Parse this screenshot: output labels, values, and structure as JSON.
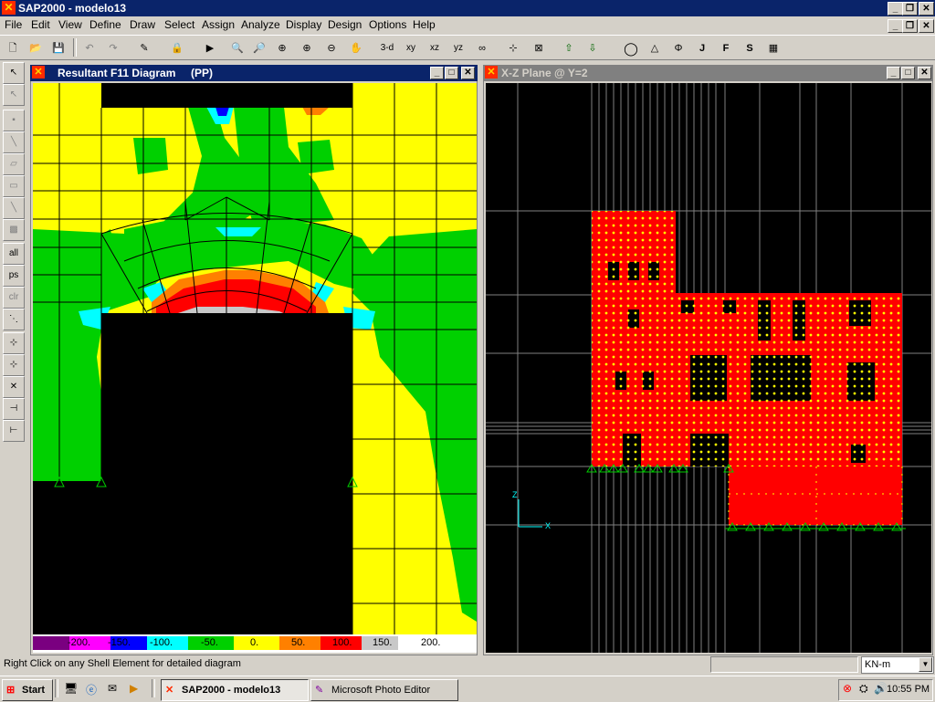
{
  "app": {
    "title": "SAP2000 - modelo13",
    "icon": "sap-logo-icon"
  },
  "menu": [
    "File",
    "Edit",
    "View",
    "Define",
    "Draw",
    "Select",
    "Assign",
    "Analyze",
    "Display",
    "Design",
    "Options",
    "Help"
  ],
  "toolbar": {
    "view_buttons": [
      "3-d",
      "xy",
      "xz",
      "yz"
    ]
  },
  "left_window": {
    "title": "Resultant F11 Diagram",
    "case": "(PP)",
    "legend": {
      "labels": [
        "-200.",
        "-150.",
        "-100.",
        "-50.",
        "0.",
        "50.",
        "100.",
        "150.",
        "200."
      ],
      "colors": [
        "#7a0080",
        "#ff00ff",
        "#0000ff",
        "#00ffff",
        "#00d000",
        "#ffff00",
        "#ff8000",
        "#ff0000",
        "#c8c8c8"
      ]
    }
  },
  "right_window": {
    "title": "X-Z Plane @ Y=2",
    "axis_z": "Z",
    "axis_x": "X"
  },
  "status": {
    "message": "Right Click on any Shell Element for detailed diagram",
    "units": "KN-m"
  },
  "taskbar": {
    "start": "Start",
    "items": [
      "SAP2000 - modelo13",
      "Microsoft Photo Editor"
    ],
    "clock": "10:55 PM"
  },
  "colors": {
    "titlebar": "#0a246a",
    "inactive_titlebar": "#808080",
    "model_red": "#ff0000",
    "node_yellow": "#ffff00",
    "support_green": "#00cc00"
  }
}
